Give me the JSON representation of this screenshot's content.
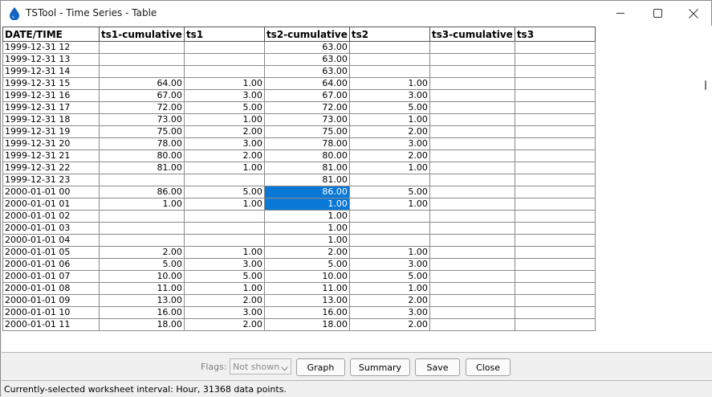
{
  "window": {
    "title": "TSTool - Time Series - Table",
    "icon": "water-drop-icon",
    "controls": [
      "minimize-icon",
      "maximize-icon",
      "close-icon"
    ]
  },
  "table": {
    "columns": [
      "DATE/TIME",
      "ts1-cumulative",
      "ts1",
      "ts2-cumulative",
      "ts2",
      "ts3-cumulative",
      "ts3"
    ],
    "selected_color": "#0a78d7",
    "selected_cells": [
      [
        12,
        3
      ],
      [
        13,
        3
      ]
    ],
    "rows": [
      [
        "1999-12-31 12",
        "",
        "",
        "63.00",
        "",
        "",
        ""
      ],
      [
        "1999-12-31 13",
        "",
        "",
        "63.00",
        "",
        "",
        ""
      ],
      [
        "1999-12-31 14",
        "",
        "",
        "63.00",
        "",
        "",
        ""
      ],
      [
        "1999-12-31 15",
        "64.00",
        "1.00",
        "64.00",
        "1.00",
        "",
        ""
      ],
      [
        "1999-12-31 16",
        "67.00",
        "3.00",
        "67.00",
        "3.00",
        "",
        ""
      ],
      [
        "1999-12-31 17",
        "72.00",
        "5.00",
        "72.00",
        "5.00",
        "",
        ""
      ],
      [
        "1999-12-31 18",
        "73.00",
        "1.00",
        "73.00",
        "1.00",
        "",
        ""
      ],
      [
        "1999-12-31 19",
        "75.00",
        "2.00",
        "75.00",
        "2.00",
        "",
        ""
      ],
      [
        "1999-12-31 20",
        "78.00",
        "3.00",
        "78.00",
        "3.00",
        "",
        ""
      ],
      [
        "1999-12-31 21",
        "80.00",
        "2.00",
        "80.00",
        "2.00",
        "",
        ""
      ],
      [
        "1999-12-31 22",
        "81.00",
        "1.00",
        "81.00",
        "1.00",
        "",
        ""
      ],
      [
        "1999-12-31 23",
        "",
        "",
        "81.00",
        "",
        "",
        ""
      ],
      [
        "2000-01-01 00",
        "86.00",
        "5.00",
        "86.00",
        "5.00",
        "",
        ""
      ],
      [
        "2000-01-01 01",
        "1.00",
        "1.00",
        "1.00",
        "1.00",
        "",
        ""
      ],
      [
        "2000-01-01 02",
        "",
        "",
        "1.00",
        "",
        "",
        ""
      ],
      [
        "2000-01-01 03",
        "",
        "",
        "1.00",
        "",
        "",
        ""
      ],
      [
        "2000-01-01 04",
        "",
        "",
        "1.00",
        "",
        "",
        ""
      ],
      [
        "2000-01-01 05",
        "2.00",
        "1.00",
        "2.00",
        "1.00",
        "",
        ""
      ],
      [
        "2000-01-01 06",
        "5.00",
        "3.00",
        "5.00",
        "3.00",
        "",
        ""
      ],
      [
        "2000-01-01 07",
        "10.00",
        "5.00",
        "10.00",
        "5.00",
        "",
        ""
      ],
      [
        "2000-01-01 08",
        "11.00",
        "1.00",
        "11.00",
        "1.00",
        "",
        ""
      ],
      [
        "2000-01-01 09",
        "13.00",
        "2.00",
        "13.00",
        "2.00",
        "",
        ""
      ],
      [
        "2000-01-01 10",
        "16.00",
        "3.00",
        "16.00",
        "3.00",
        "",
        ""
      ],
      [
        "2000-01-01 11",
        "18.00",
        "2.00",
        "18.00",
        "2.00",
        "",
        ""
      ]
    ]
  },
  "toolbar": {
    "flags_label": "Flags:",
    "flags_value": "Not shown",
    "graph_label": "Graph",
    "summary_label": "Summary",
    "save_label": "Save",
    "close_label": "Close"
  },
  "status": {
    "text": "Currently-selected worksheet interval: Hour, 31368 data points."
  }
}
